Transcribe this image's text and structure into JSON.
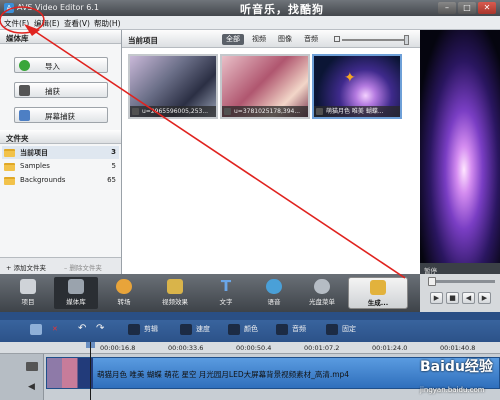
{
  "titlebar": {
    "title": "AVS Video Editor 6.1",
    "slogan": "听音乐，找酷狗",
    "min": "–",
    "max": "□",
    "close": "✕"
  },
  "menu": [
    "文件(F)",
    "编辑(E)",
    "查看(V)",
    "帮助(H)"
  ],
  "media_library": {
    "header": "媒体库",
    "buttons": [
      {
        "label": "导入",
        "icon": "import-icon"
      },
      {
        "label": "捕获",
        "icon": "capture-icon"
      },
      {
        "label": "屏幕捕获",
        "icon": "screen-capture-icon"
      }
    ],
    "folders_header": "文件夹",
    "folders": [
      {
        "name": "当前项目",
        "count": "3"
      },
      {
        "name": "Samples",
        "count": "5"
      },
      {
        "name": "Backgrounds",
        "count": "65"
      }
    ],
    "add_folder": "+ 添加文件夹",
    "remove_folder": "– 删除文件夹"
  },
  "library": {
    "title": "当前项目",
    "tabs": [
      "全部",
      "视频",
      "图像",
      "音频"
    ],
    "active_tab": "全部",
    "items": [
      {
        "caption": "u=2965596005,253..."
      },
      {
        "caption": "u=3781025178,394..."
      },
      {
        "caption": "萌猫月色 唯美 蝴蝶..."
      }
    ]
  },
  "preview": {
    "status": "暂停"
  },
  "toolbar": {
    "items": [
      "项目",
      "媒体库",
      "转场",
      "视频效果",
      "文字",
      "语音",
      "光盘菜单",
      "生成..."
    ],
    "active": "媒体库"
  },
  "timeline_toolbar": {
    "items": [
      "剪辑",
      "速度",
      "颜色",
      "音频",
      "固定"
    ]
  },
  "ruler": [
    "00:00:16.8",
    "00:00:33.6",
    "00:00:50.4",
    "00:01:07.2",
    "00:01:24.0",
    "00:01:40.8"
  ],
  "clip": {
    "title": "萌猫月色 唯美 蝴蝶 萌花 星空 月光园月LED大屏幕背景视频素材_高清.mp4"
  },
  "watermark": {
    "brand": "Baidu经验",
    "url": "jingyan.baidu.com"
  },
  "colors": {
    "accent": "#2c5289",
    "toolbar": "#4a5057",
    "annotation": "#e0231f"
  }
}
